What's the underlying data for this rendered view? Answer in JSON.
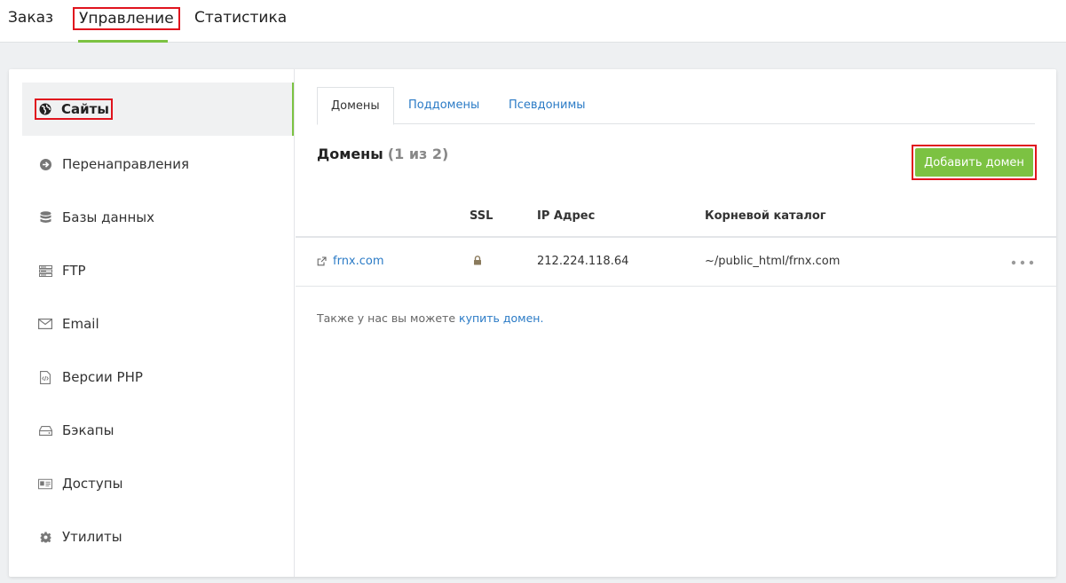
{
  "topnav": {
    "tabs": [
      {
        "label": "Заказ"
      },
      {
        "label": "Управление"
      },
      {
        "label": "Статистика"
      }
    ]
  },
  "sidebar": {
    "items": [
      {
        "label": "Сайты",
        "icon": "globe-icon"
      },
      {
        "label": "Перенаправления",
        "icon": "arrow-circle-right-icon"
      },
      {
        "label": "Базы данных",
        "icon": "database-icon"
      },
      {
        "label": "FTP",
        "icon": "server-icon"
      },
      {
        "label": "Email",
        "icon": "envelope-icon"
      },
      {
        "label": "Версии PHP",
        "icon": "code-file-icon"
      },
      {
        "label": "Бэкапы",
        "icon": "hdd-icon"
      },
      {
        "label": "Доступы",
        "icon": "id-card-icon"
      },
      {
        "label": "Утилиты",
        "icon": "gear-icon"
      }
    ]
  },
  "main": {
    "tabs": [
      {
        "label": "Домены"
      },
      {
        "label": "Поддомены"
      },
      {
        "label": "Псевдонимы"
      }
    ],
    "heading": "Домены",
    "heading_count": "(1 из 2)",
    "add_button": "Добавить домен",
    "table": {
      "headers": {
        "ssl": "SSL",
        "ip": "IP Адрес",
        "root": "Корневой каталог"
      },
      "rows": [
        {
          "domain": "frnx.com",
          "ip": "212.224.118.64",
          "root": "~/public_html/frnx.com"
        }
      ]
    },
    "note_text": "Также у нас вы можете ",
    "note_link": "купить домен."
  },
  "colors": {
    "accent_green": "#7cc242",
    "link_blue": "#2b7bc6",
    "highlight_red": "#e0141e"
  }
}
